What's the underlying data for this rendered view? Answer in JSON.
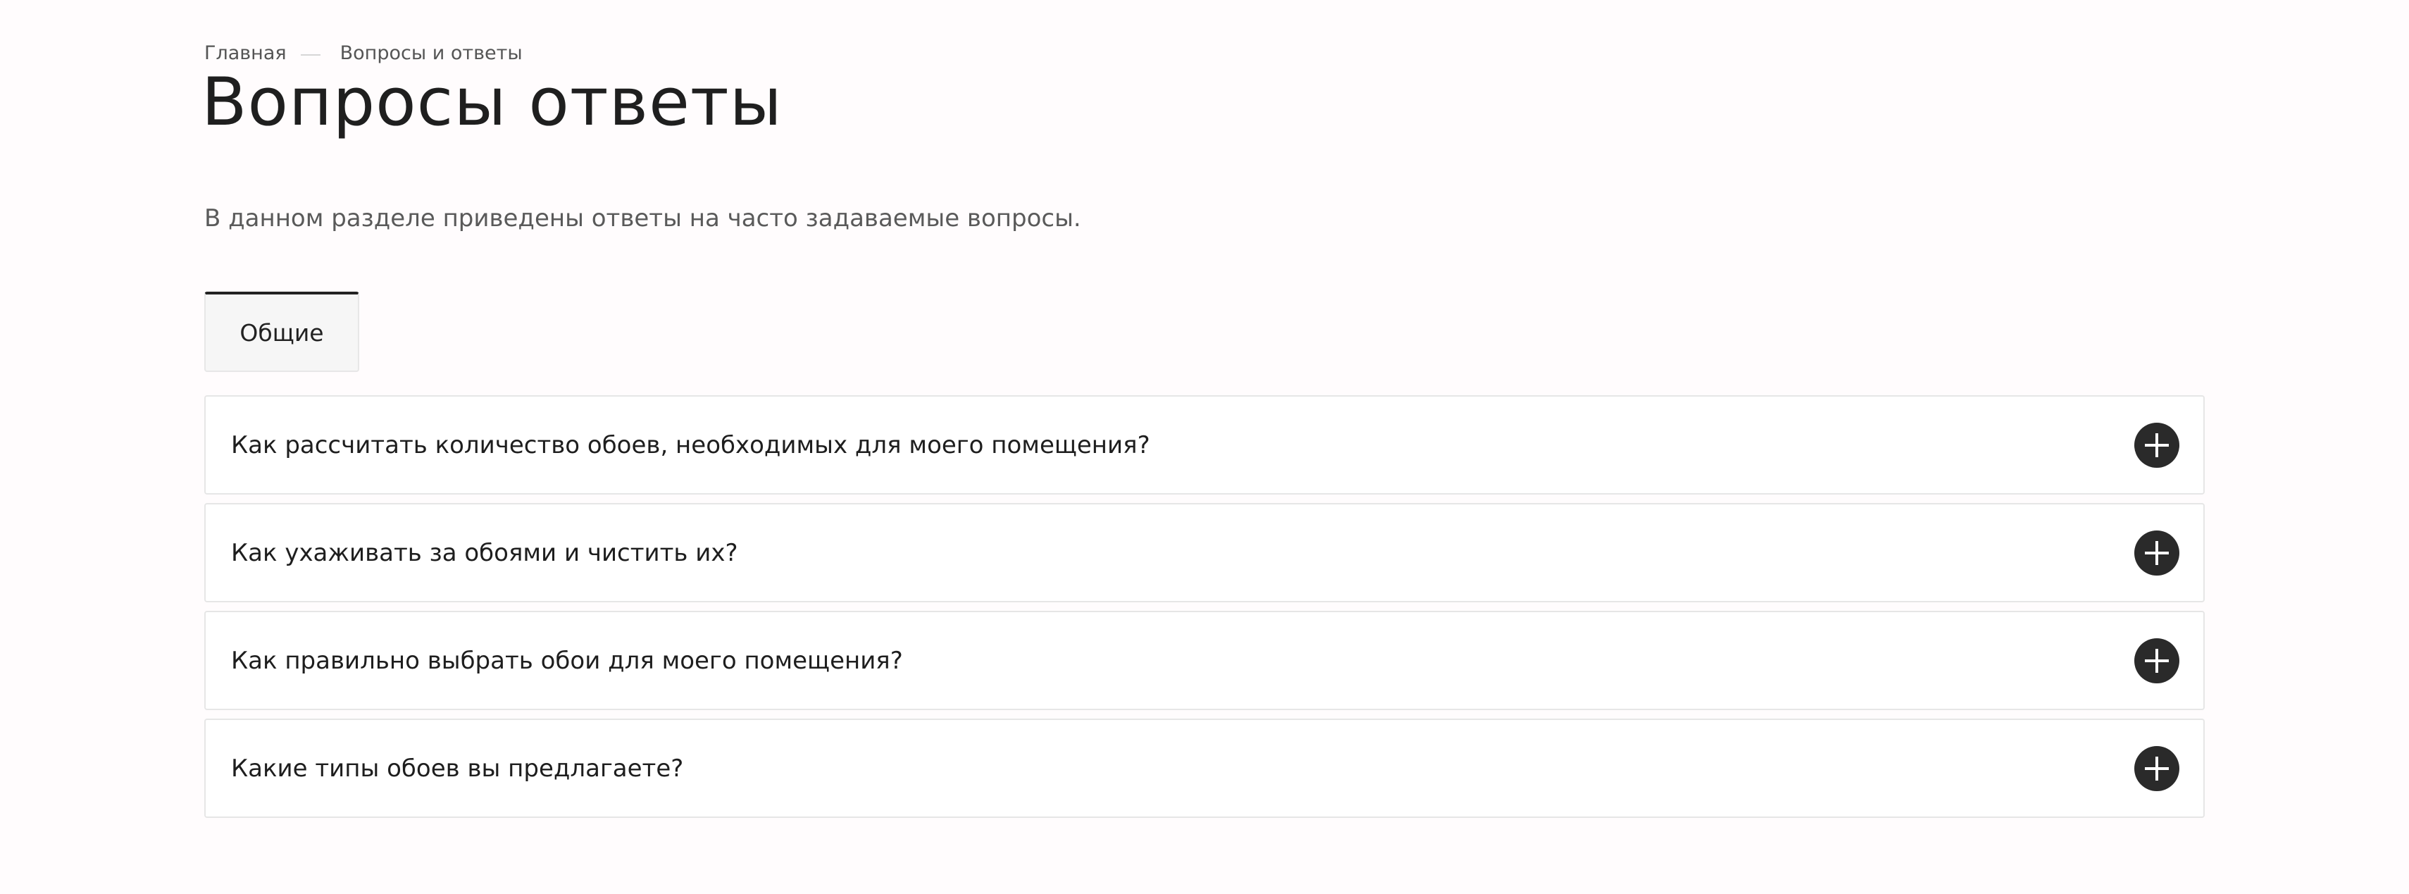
{
  "breadcrumb": {
    "home": "Главная",
    "current": "Вопросы и ответы"
  },
  "page": {
    "title": "Вопросы ответы",
    "intro": "В данном разделе приведены ответы на часто задаваемые вопросы."
  },
  "tabs": [
    {
      "label": "Общие",
      "active": true
    }
  ],
  "faq": [
    {
      "question": "Как рассчитать количество обоев, необходимых для моего помещения?",
      "icon": "plus-icon"
    },
    {
      "question": "Как ухаживать за обоями и чистить их?",
      "icon": "plus-icon"
    },
    {
      "question": "Как правильно выбрать обои для моего помещения?",
      "icon": "plus-icon"
    },
    {
      "question": "Какие типы обоев вы предлагаете?",
      "icon": "plus-icon"
    }
  ],
  "colors": {
    "background": "#fffcfd",
    "accent": "#2a2a2a",
    "text": "#222222",
    "muted": "#5a5a5a"
  }
}
